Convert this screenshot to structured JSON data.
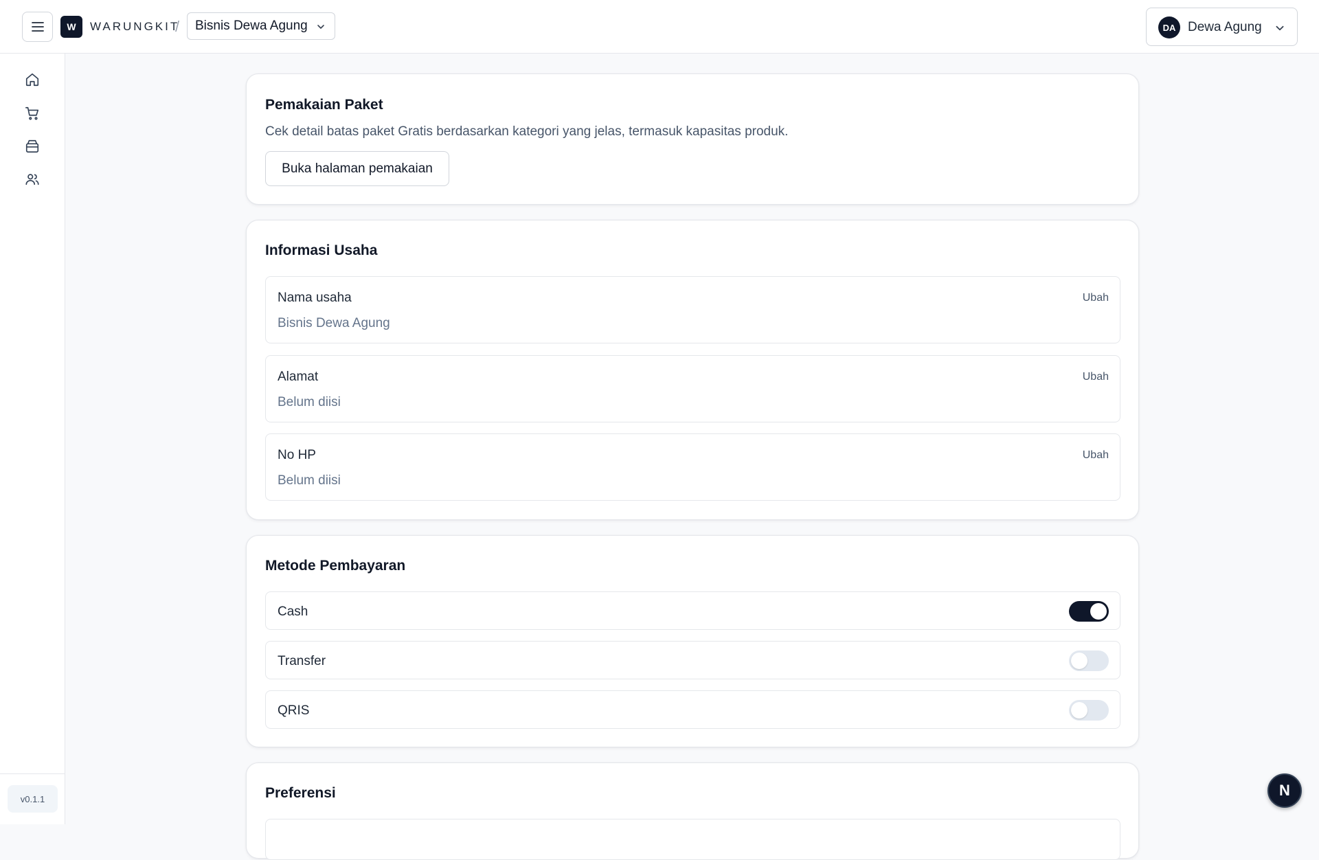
{
  "header": {
    "logo_letter": "W",
    "brand": "WARUNGKIT",
    "separator": "/",
    "business_selector": "Bisnis Dewa Agung",
    "user_initials": "DA",
    "user_name": "Dewa Agung"
  },
  "sidebar": {
    "items": [
      {
        "icon": "home-icon"
      },
      {
        "icon": "cart-icon"
      },
      {
        "icon": "box-icon"
      },
      {
        "icon": "users-icon"
      }
    ],
    "version": "v0.1.1"
  },
  "usage_card": {
    "title": "Pemakaian Paket",
    "description": "Cek detail batas paket Gratis berdasarkan kategori yang jelas, termasuk kapasitas produk.",
    "button_label": "Buka halaman pemakaian"
  },
  "business_info": {
    "title": "Informasi Usaha",
    "fields": [
      {
        "label": "Nama usaha",
        "value": "Bisnis Dewa Agung",
        "action": "Ubah"
      },
      {
        "label": "Alamat",
        "value": "Belum diisi",
        "action": "Ubah"
      },
      {
        "label": "No HP",
        "value": "Belum diisi",
        "action": "Ubah"
      }
    ]
  },
  "payment_methods": {
    "title": "Metode Pembayaran",
    "methods": [
      {
        "label": "Cash",
        "enabled": true
      },
      {
        "label": "Transfer",
        "enabled": false
      },
      {
        "label": "QRIS",
        "enabled": false
      }
    ]
  },
  "preferences": {
    "title": "Preferensi"
  },
  "dev_badge": "N",
  "colors": {
    "primary": "#0f172a",
    "border": "#e5e7eb",
    "muted_text": "#64748b",
    "toggle_off": "#e2e8f0"
  }
}
